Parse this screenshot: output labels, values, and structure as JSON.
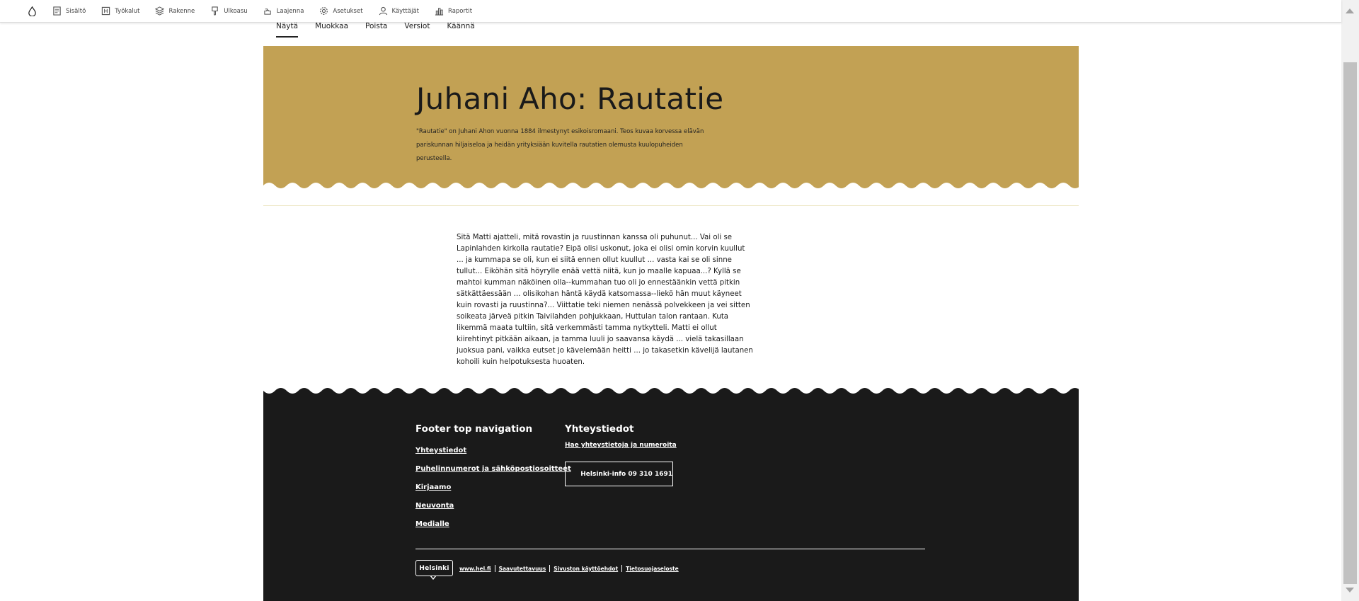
{
  "toolbar": {
    "items": [
      {
        "label": "Sisältö",
        "icon": "document-icon"
      },
      {
        "label": "Työkalut",
        "icon": "tools-icon"
      },
      {
        "label": "Rakenne",
        "icon": "structure-icon"
      },
      {
        "label": "Ulkoasu",
        "icon": "appearance-icon"
      },
      {
        "label": "Laajenna",
        "icon": "extend-icon"
      },
      {
        "label": "Asetukset",
        "icon": "gear-icon"
      },
      {
        "label": "Käyttäjät",
        "icon": "user-icon"
      },
      {
        "label": "Raportit",
        "icon": "reports-icon"
      }
    ]
  },
  "tabs": [
    {
      "label": "Näytä",
      "active": true
    },
    {
      "label": "Muokkaa",
      "active": false
    },
    {
      "label": "Poista",
      "active": false
    },
    {
      "label": "Versiot",
      "active": false
    },
    {
      "label": "Käännä",
      "active": false
    }
  ],
  "hero": {
    "title": "Juhani Aho: Rautatie",
    "lead": "\"Rautatie\" on Juhani Ahon vuonna 1884 ilmestynyt esikoisromaani. Teos kuvaa korvessa elävän pariskunnan hiljaiseloa ja heidän yrityksiään kuvitella rautatien olemusta kuulopuheiden perusteella.",
    "color": "#c2a154"
  },
  "body": {
    "text": "Sitä Matti ajatteli, mitä rovastin ja ruustinnan kanssa oli puhunut... Vai oli se Lapinlahden kirkolla rautatie? Eipä olisi uskonut, joka ei olisi omin korvin kuullut ... ja kummapa se oli, kun ei siitä ennen ollut kuullut ... vasta kai se oli sinne tullut... Eiköhän sitä höyrylle enää vettä niitä, kun jo maalle kapuaa...? Kyllä se mahtoi kumman näköinen olla--kummahan tuo oli jo ennestäänkin vettä pitkin sätkättäessään ... olisikohan häntä käydä katsomassa--liekö hän muut käyneet kuin rovasti ja ruustinna?... Viittatie teki niemen nenässä polvekkeen ja vei sitten soikeata järveä pitkin Taivilahden pohjukkaan, Huttulan talon rantaan. Kuta likemmä maata tultiin, sitä verkemmästi tamma nytkytteli. Matti ei ollut kiirehtinyt pitkään aikaan, ja tamma luuli jo saavansa käydä ... vielä takasillaan juoksua pani, vaikka eutset jo kävelemään heitti ... jo takasetkin kävelijä lautanen kohoili kuin helpotuksesta huoaten."
  },
  "footer": {
    "nav_title": "Footer top navigation",
    "nav_items": [
      "Yhteystiedot",
      "Puhelinnumerot ja sähköpostiosoitteet",
      "Kirjaamo",
      "Neuvonta",
      "Medialle"
    ],
    "contact_title": "Yhteystiedot",
    "contact_link": "Hae yhteystietoja ja numeroita",
    "phone_label": "Helsinki-info 09 310 1691",
    "logo_text": "Helsinki",
    "bottom_links": [
      "www.hel.fi",
      "Saavutettavuus",
      "Sivuston käyttöehdot",
      "Tietosuojaseloste"
    ],
    "color": "#1a1a1a"
  }
}
